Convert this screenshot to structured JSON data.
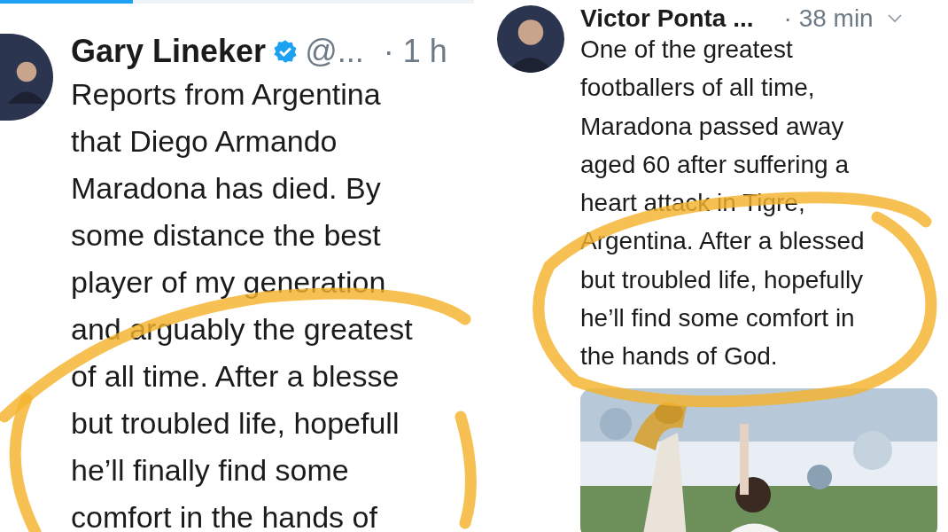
{
  "progress_bar": {
    "level": 0.28
  },
  "tweets": [
    {
      "author": "Gary Lineker",
      "verified": true,
      "handle": "@...",
      "time": "· 1 h",
      "menu": false,
      "lines": [
        "Reports from Argentina",
        "that Diego Armando",
        "Maradona has died. By",
        "some distance the best",
        "player of my generation",
        "and arguably the greatest",
        "of all time. After a blesse",
        "but troubled life, hopefull",
        "he’ll finally find some",
        "comfort in the hands of"
      ]
    },
    {
      "author": "Victor Ponta ...",
      "verified": false,
      "time": "· 38 min",
      "menu": true,
      "lines": [
        "One of the greatest",
        "footballers of all time,",
        "Maradona passed away",
        "aged 60 after suffering a",
        "heart attack in Tigre,",
        "Argentina. After a blessed",
        "but troubled life, hopefully",
        "he’ll find some comfort in",
        "the hands of God."
      ],
      "media": {
        "kind": "picture"
      }
    }
  ]
}
